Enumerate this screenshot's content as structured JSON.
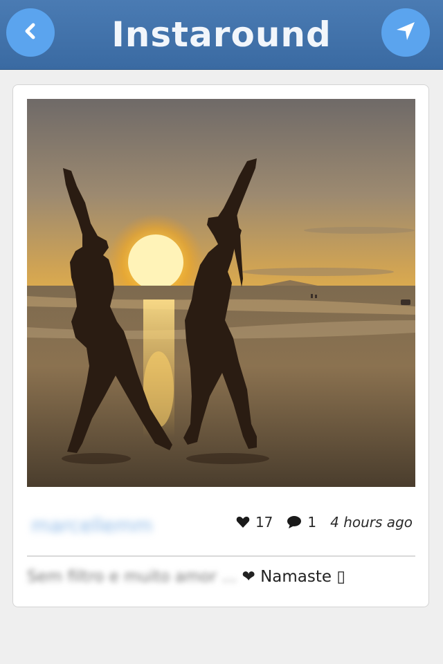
{
  "app": {
    "title": "Instaround"
  },
  "nav": {
    "back_icon": "chevron-left-icon",
    "locate_icon": "location-arrow-icon"
  },
  "post": {
    "username": "marcellemm",
    "likes": "17",
    "comments": "1",
    "time": "4 hours ago",
    "caption_blurred": "Sem filtro e muito amor ...",
    "caption_visible": "❤ Namaste ▯",
    "image_description": "silhouette-beach-sunset-photo"
  },
  "colors": {
    "navbar": "#3f70a9",
    "nav_button": "#5ba4ee",
    "background": "#efefef",
    "card": "#ffffff",
    "username": "#8bb7e6"
  }
}
